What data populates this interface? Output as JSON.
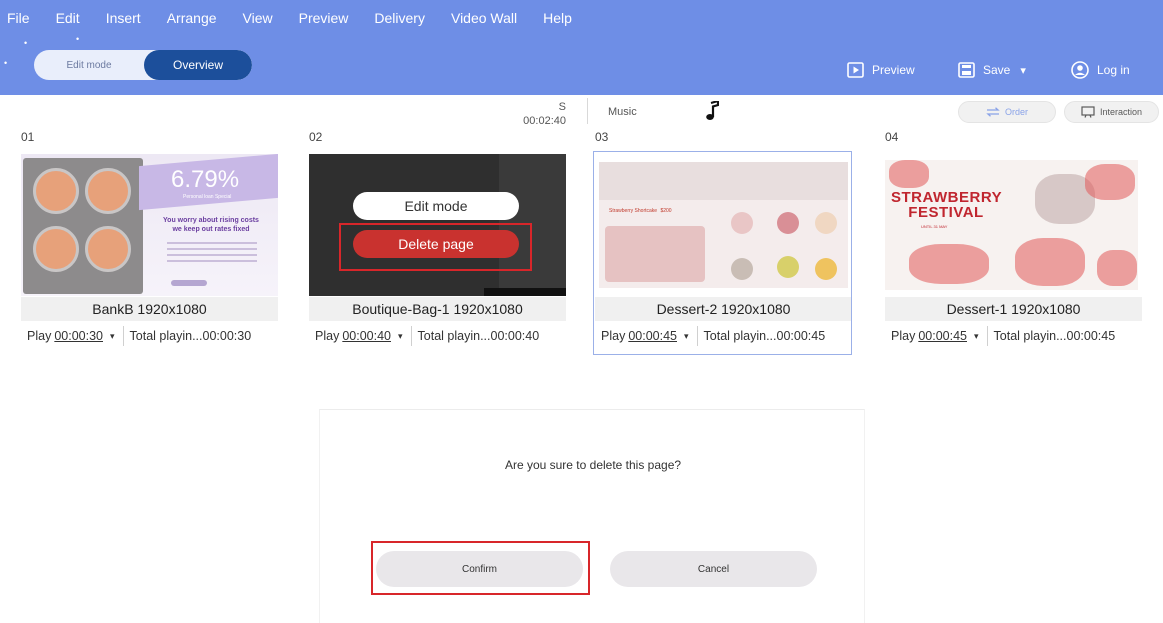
{
  "menu": [
    "File",
    "Edit",
    "Insert",
    "Arrange",
    "View",
    "Preview",
    "Delivery",
    "Video Wall",
    "Help"
  ],
  "mode_toggle": {
    "edit_label": "Edit mode",
    "overview_label": "Overview"
  },
  "top_actions": {
    "preview": "Preview",
    "save": "Save",
    "save_caret": "▾",
    "login": "Log in"
  },
  "info_row": {
    "duration_letter": "S",
    "duration": "00:02:40",
    "music_label": "Music"
  },
  "tool_buttons": {
    "order": "Order",
    "interaction": "Interaction"
  },
  "pages": [
    {
      "number": "01",
      "name": "BankB 1920x1080",
      "play_label": "Play",
      "play_time": "00:00:30",
      "caret": "▾",
      "total": "Total playin...00:00:30"
    },
    {
      "number": "02",
      "name": "Boutique-Bag-1 1920x1080",
      "play_label": "Play",
      "play_time": "00:00:40",
      "caret": "▾",
      "total": "Total playin...00:00:40"
    },
    {
      "number": "03",
      "name": "Dessert-2 1920x1080",
      "play_label": "Play",
      "play_time": "00:00:45",
      "caret": "▾",
      "total": "Total playin...00:00:45"
    },
    {
      "number": "04",
      "name": "Dessert-1 1920x1080",
      "play_label": "Play",
      "play_time": "00:00:45",
      "caret": "▾",
      "total": "Total playin...00:00:45"
    }
  ],
  "thumb_text": {
    "bank_percent": "6.79%",
    "bank_subtitle": "Personal loan Special",
    "bank_headline_1": "You worry about rising costs",
    "bank_headline_2": "we keep out rates fixed",
    "dessert_title": "Strawberry Shortcake",
    "dessert_price": "$200",
    "festival_title_1": "STRAWBERRY",
    "festival_title_2": "FESTIVAL",
    "festival_date": "UNTIL 31 MAY"
  },
  "page_overlay": {
    "edit_mode": "Edit mode",
    "delete_page": "Delete page"
  },
  "dialog": {
    "message": "Are you sure to delete this page?",
    "confirm": "Confirm",
    "cancel": "Cancel"
  },
  "colors": {
    "topbar": "#6e8ee6",
    "overview_active": "#1c4f9b",
    "delete_red": "#c9322f",
    "highlight_red": "#d8262a"
  }
}
